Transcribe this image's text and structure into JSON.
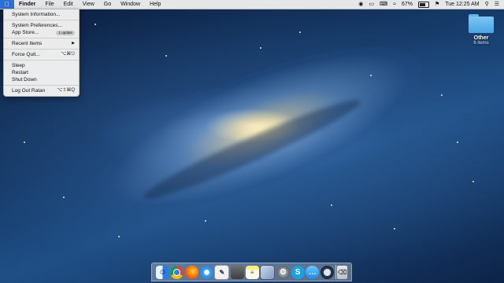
{
  "menubar": {
    "apple_icon": "apple-logo-icon",
    "items": [
      "Finder",
      "File",
      "Edit",
      "View",
      "Go",
      "Window",
      "Help"
    ],
    "status": {
      "battery_percent": "67%",
      "clock": "Tue 12:25 AM",
      "icons": [
        "record-icon",
        "cast-icon",
        "keyboard-icon",
        "wifi-icon",
        "battery-icon",
        "flag-icon",
        "search-icon",
        "list-icon"
      ]
    }
  },
  "apple_menu": {
    "system_information": "System Information...",
    "system_preferences": "System Preferences...",
    "app_store": "App Store...",
    "app_store_badge": "1 update",
    "recent_items": "Recent Items",
    "force_quit": "Force Quit...",
    "force_quit_shortcut": "⌥⌘⎋",
    "sleep": "Sleep",
    "restart": "Restart",
    "shut_down": "Shut Down",
    "log_out": "Log Out Ratan",
    "log_out_shortcut": "⌥⇧⌘Q"
  },
  "desktop": {
    "folder": {
      "name": "Other",
      "subtitle": "6 items"
    }
  },
  "dock": {
    "apps": [
      "finder",
      "chrome",
      "firefox",
      "safari",
      "textedit",
      "preview",
      "notes",
      "photo-viewer",
      "system-preferences",
      "skype",
      "messages",
      "quicktime",
      "trash"
    ]
  },
  "colors": {
    "menu_accent": "#2f6fd6",
    "folder_blue": "#49a5e3"
  }
}
